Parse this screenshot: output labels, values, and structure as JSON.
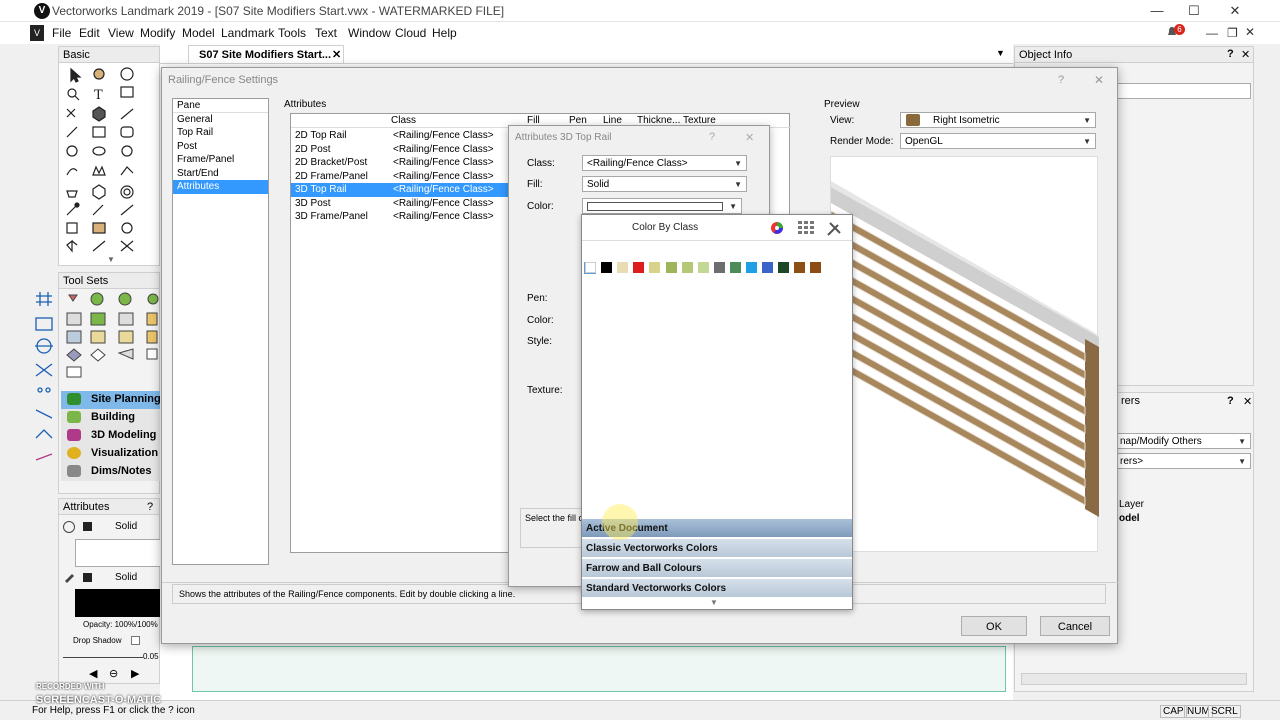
{
  "window": {
    "title": "Vectorworks Landmark 2019 - [S07 Site Modifiers Start.vwx - WATERMARKED FILE]",
    "app_icon": "V",
    "minimize": "—",
    "maximize": "☐",
    "close": "✕"
  },
  "menus": [
    "File",
    "Edit",
    "View",
    "Modify",
    "Model",
    "Landmark",
    "Tools",
    "Text",
    "Window",
    "Cloud",
    "Help"
  ],
  "notif_count": "6",
  "doc_tab": {
    "label": "S07 Site Modifiers Start...",
    "close": "✕"
  },
  "object_info": {
    "title": "Object Info",
    "help": "?",
    "close": "✕"
  },
  "basic": {
    "title": "Basic"
  },
  "tool_sets": {
    "title": "Tool Sets"
  },
  "workspaces": [
    "Site Planning",
    "Building Shell",
    "3D Modeling",
    "Visualization",
    "Dims/Notes"
  ],
  "attributes_palette": {
    "title": "Attributes",
    "help": "?",
    "fill_label": "Solid",
    "pen_label": "Solid",
    "opacity": "Opacity: 100%/100%",
    "drop_shadow": "Drop Shadow",
    "line_weight": "0.05"
  },
  "right_panel": {
    "title": "rers",
    "help": "?",
    "close": "✕",
    "mode": "nap/Modify Others",
    "others": "rers>",
    "col_layer": "Layer",
    "model": "odel"
  },
  "dialog": {
    "title": "Railing/Fence Settings",
    "help": "?",
    "close": "✕",
    "pane_label": "Pane",
    "panes": [
      "General",
      "Top Rail",
      "Post",
      "Frame/Panel",
      "Start/End",
      "Attributes"
    ],
    "attributes_label": "Attributes",
    "table_headers": [
      "Class",
      "Fill",
      "Pen",
      "Line",
      "Thickne...",
      "Texture"
    ],
    "rows": [
      {
        "name": "2D Top Rail",
        "cls": "<Railing/Fence Class>"
      },
      {
        "name": "2D Post",
        "cls": "<Railing/Fence Class>"
      },
      {
        "name": "2D Bracket/Post",
        "cls": "<Railing/Fence Class>"
      },
      {
        "name": "2D Frame/Panel",
        "cls": "<Railing/Fence Class>"
      },
      {
        "name": "3D Top Rail",
        "cls": "<Railing/Fence Class>"
      },
      {
        "name": "3D Post",
        "cls": "<Railing/Fence Class>"
      },
      {
        "name": "3D Frame/Panel",
        "cls": "<Railing/Fence Class>"
      }
    ],
    "preview_label": "Preview",
    "view_label": "View:",
    "view_value": "Right Isometric",
    "render_label": "Render Mode:",
    "render_value": "OpenGL",
    "status": "Shows the attributes of the Railing/Fence components. Edit by double clicking a line.",
    "ok": "OK",
    "cancel": "Cancel"
  },
  "sub_dialog": {
    "title": "Attributes 3D Top Rail",
    "help": "?",
    "close": "✕",
    "class_label": "Class:",
    "class_value": "<Railing/Fence Class>",
    "fill_label": "Fill:",
    "fill_value": "Solid",
    "color_label": "Color:",
    "pen_label": "Pen:",
    "color2_label": "Color:",
    "style_label": "Style:",
    "texture_label": "Texture:",
    "hint": "Select the fill c"
  },
  "color_popup": {
    "by_class": "Color By Class",
    "swatches": [
      "#ffffff",
      "#000000",
      "#e8dcb5",
      "#dc1e1e",
      "#d8d28a",
      "#a0b45a",
      "#b4c878",
      "#c2d894",
      "#6e6e6e",
      "#4b8c5a",
      "#1ea0e6",
      "#3c64c8",
      "#1e4628",
      "#8c5014",
      "#8c4b14"
    ],
    "categories": [
      "Active Document",
      "Classic Vectorworks Colors",
      "Farrow and Ball Colours",
      "Standard Vectorworks Colors"
    ]
  },
  "status_bar": {
    "help": "For Help, press F1 or click the ? icon",
    "keys": [
      "CAP",
      "NUM",
      "SCRL"
    ],
    "watermark1": "RECORDED WITH",
    "watermark2": "SCREENCAST-O-MATIC"
  }
}
